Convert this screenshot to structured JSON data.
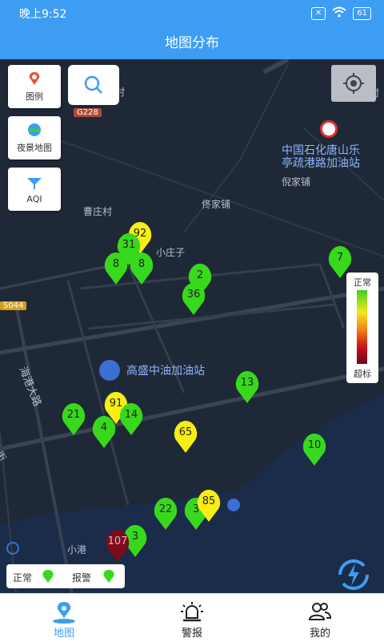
{
  "status_bar": {
    "time": "晚上9:52",
    "battery": "61"
  },
  "title": "地图分布",
  "map": {
    "labels": {
      "village_top": "村",
      "road_g228": "G228",
      "cao_zhuang": "曹庄村",
      "tong_jia_pu": "佟家铺",
      "ni_jia_pu": "倪家铺",
      "sinopec_line1": "中国石化唐山乐",
      "sinopec_line2": "亭疏港路加油站",
      "xiao_zhuang": "小庄子",
      "road_s044": "S044",
      "gaosheng": "高盛中油加油站",
      "haigang": "海港大路",
      "jie": "大街",
      "xiao_gang": "小港",
      "tian_cun": "田村"
    },
    "buttons": {
      "legend": "图例",
      "night_map": "夜景地图",
      "aqi": "AQI"
    },
    "gauge": {
      "top": "正常",
      "bottom": "超标"
    },
    "status_legend": {
      "normal": "正常",
      "alarm": "报警"
    },
    "colors": {
      "green": "#38d91c",
      "yellow": "#f7ee13",
      "darkred": "#7a0c1d"
    },
    "markers": [
      {
        "v": "92",
        "c": "yellow"
      },
      {
        "v": "31",
        "c": "green"
      },
      {
        "v": "8",
        "c": "green"
      },
      {
        "v": "8",
        "c": "green"
      },
      {
        "v": "2",
        "c": "green"
      },
      {
        "v": "36",
        "c": "green"
      },
      {
        "v": "7",
        "c": "green"
      },
      {
        "v": "13",
        "c": "green"
      },
      {
        "v": "91",
        "c": "yellow"
      },
      {
        "v": "14",
        "c": "green"
      },
      {
        "v": "21",
        "c": "green"
      },
      {
        "v": "4",
        "c": "green"
      },
      {
        "v": "65",
        "c": "yellow"
      },
      {
        "v": "10",
        "c": "green"
      },
      {
        "v": "22",
        "c": "green"
      },
      {
        "v": "3",
        "c": "green"
      },
      {
        "v": "85",
        "c": "yellow"
      },
      {
        "v": "3",
        "c": "green"
      },
      {
        "v": "107",
        "c": "darkred"
      }
    ]
  },
  "tabs": [
    {
      "label": "地图"
    },
    {
      "label": "警报"
    },
    {
      "label": "我的"
    }
  ]
}
